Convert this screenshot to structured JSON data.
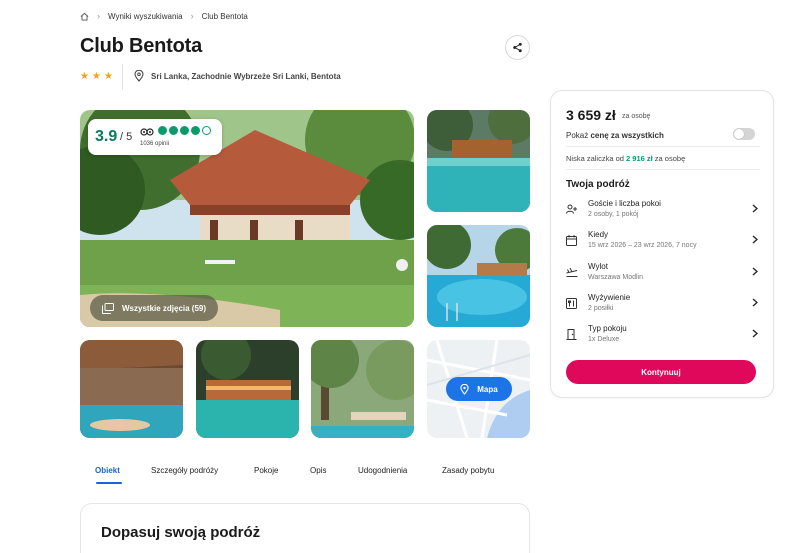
{
  "breadcrumb": {
    "items": [
      "Wyniki wyszukiwania",
      "Club Bentota"
    ]
  },
  "hotel": {
    "name": "Club Bentota",
    "stars": 3,
    "location": "Sri Lanka, Zachodnie Wybrzeże Sri Lanki, Bentota"
  },
  "rating": {
    "score": "3.9",
    "max": "/ 5",
    "reviews": "1036 opinii",
    "dots_filled": 4,
    "dots_total": 5
  },
  "gallery": {
    "all_photos_label": "Wszystkie zdjęcia (59)",
    "map_label": "Mapa"
  },
  "tabs": [
    "Obiekt",
    "Szczegóły podróży",
    "Pokoje",
    "Opis",
    "Udogodnienia",
    "Zasady pobytu"
  ],
  "section": {
    "title": "Dopasuj swoją podróż"
  },
  "booking": {
    "price": "3 659 zł",
    "per_person": "za osobę",
    "total_prefix": "Pokaż ",
    "total_bold": "cenę za wszystkich",
    "deposit_prefix": "Niska zaliczka od ",
    "deposit_amount": "2 916 zł",
    "deposit_suffix": " za osobę",
    "trip_title": "Twoja podróż",
    "rows": [
      {
        "title": "Goście i liczba pokoi",
        "sub": "2 osoby, 1 pokój",
        "icon": "guests-icon"
      },
      {
        "title": "Kiedy",
        "sub": "15 wrz 2026 – 23 wrz 2026, 7 nocy",
        "icon": "calendar-icon"
      },
      {
        "title": "Wylot",
        "sub": "Warszawa Modlin",
        "icon": "plane-icon"
      },
      {
        "title": "Wyżywienie",
        "sub": "2 posiłki",
        "icon": "meal-icon"
      },
      {
        "title": "Typ pokoju",
        "sub": "1x Deluxe",
        "icon": "door-icon"
      }
    ],
    "cta": "Kontynuuj"
  },
  "colors": {
    "accent": "#e0085b",
    "link": "#1d62d8",
    "rating": "#0b9b6b",
    "star": "#f4a01b"
  }
}
